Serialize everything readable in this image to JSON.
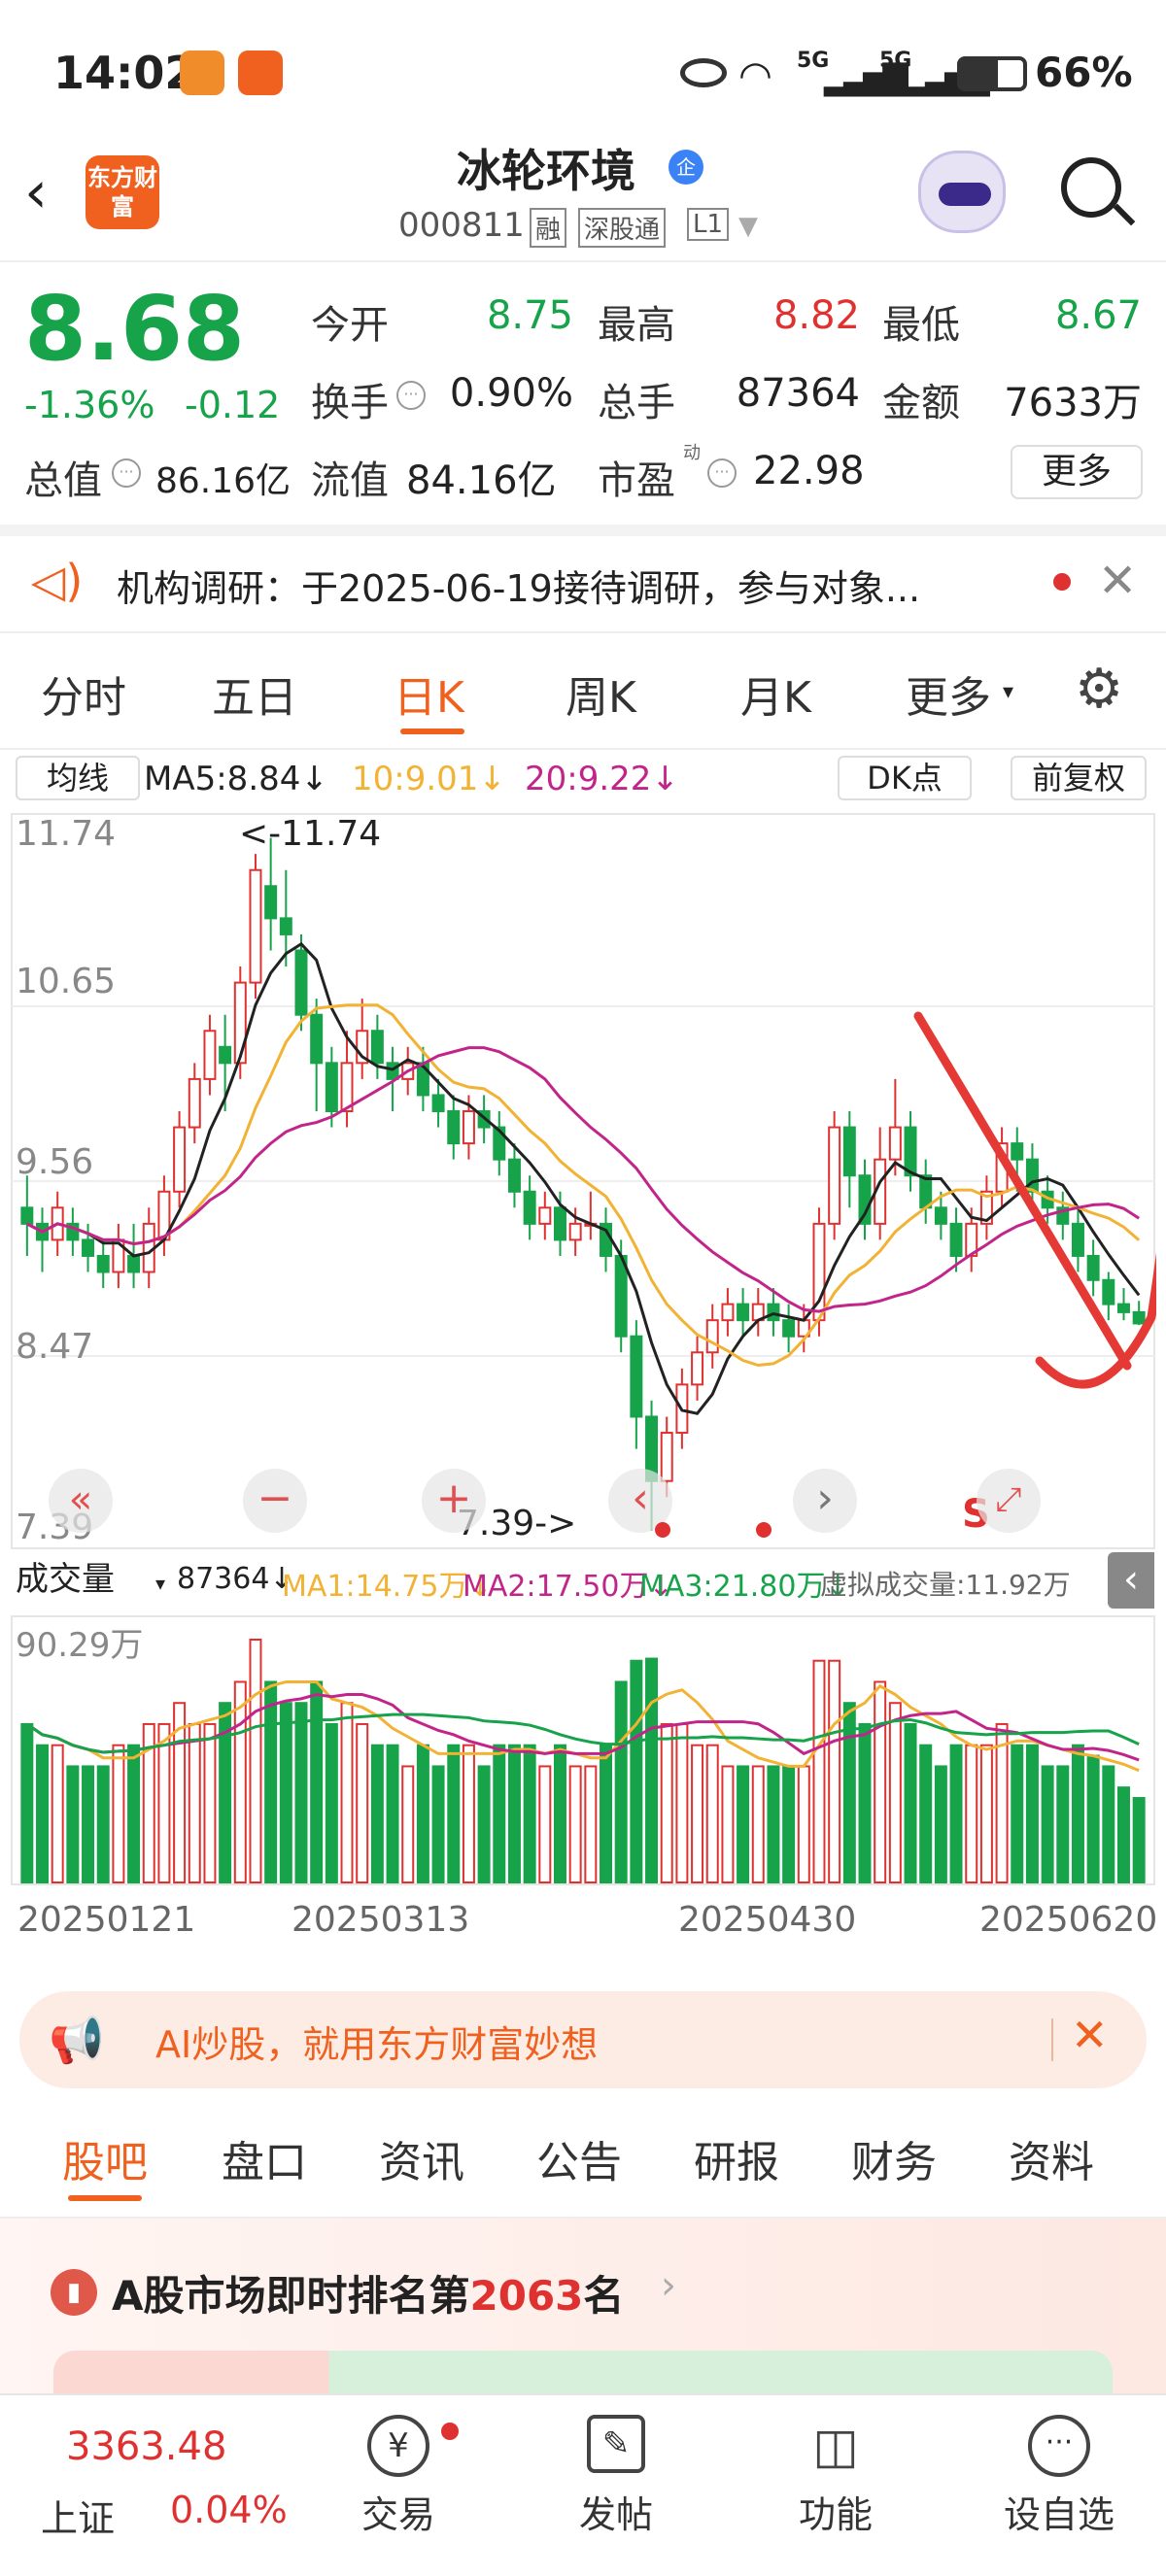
{
  "status": {
    "time": "14:02",
    "battery": "66%",
    "net1": "5G",
    "net2": "5G"
  },
  "header": {
    "logo": "东方财富",
    "name": "冰轮环境",
    "name_badge": "企",
    "code": "000811",
    "tags": [
      "融",
      "深股通",
      "L1"
    ]
  },
  "quote": {
    "price": "8.68",
    "change_pct": "-1.36%",
    "change": "-0.12",
    "open_label": "今开",
    "open": "8.75",
    "high_label": "最高",
    "high": "8.82",
    "low_label": "最低",
    "low": "8.67",
    "turnover_label": "换手",
    "turnover": "0.90%",
    "vol_label": "总手",
    "vol": "87364",
    "amount_label": "金额",
    "amount": "7633万",
    "mcap_label": "总值",
    "mcap": "86.16亿",
    "float_label": "流值",
    "float": "84.16亿",
    "pe_label": "市盈",
    "pe_sup": "动",
    "pe": "22.98",
    "more": "更多"
  },
  "notice": {
    "text": "机构调研：于2025-06-19接待调研，参与对象..."
  },
  "tabs": [
    "分时",
    "五日",
    "日K",
    "周K",
    "月K",
    "更多"
  ],
  "active_tab": "日K",
  "chart_header": {
    "ma_btn": "均线",
    "ma5": "MA5:8.84↓",
    "ma10": "10:9.01↓",
    "ma20": "20:9.22↓",
    "dk": "DK点",
    "adjust": "前复权"
  },
  "price_axis": [
    "11.74",
    "10.65",
    "9.56",
    "8.47",
    "7.39"
  ],
  "annotations": {
    "high": "<-11.74",
    "low": "7.39->"
  },
  "colors": {
    "up": "#e03131",
    "down": "#16a34a",
    "ma5": "#222222",
    "ma10": "#f2b233",
    "ma20": "#c2258a",
    "accent": "#f0601e"
  },
  "volume_header": {
    "btn": "成交量",
    "vol": "87364↓",
    "ma1": "MA1:14.75万↓",
    "ma2": "MA2:17.50万↓",
    "ma3": "MA3:21.80万↓",
    "virtual": "虚拟成交量:11.92万"
  },
  "volume_axis": "90.29万",
  "date_axis": [
    "20250121",
    "20250313",
    "20250430",
    "20250620"
  ],
  "chart_controls": {
    "s_label": "S"
  },
  "ad": {
    "text": "AI炒股，就用东方财富妙想"
  },
  "subtabs": [
    "股吧",
    "盘口",
    "资讯",
    "公告",
    "研报",
    "财务",
    "资料"
  ],
  "active_subtab": "股吧",
  "rank": {
    "prefix": "A股市场即时排名第",
    "num": "2063",
    "suffix": "名"
  },
  "bottom": {
    "index_val": "3363.48",
    "index_name": "上证",
    "index_pct": "0.04%",
    "trade": "交易",
    "post": "发帖",
    "func": "功能",
    "watch": "设自选"
  },
  "chart_data": {
    "type": "candlestick",
    "ylim": [
      7.39,
      11.74
    ],
    "candles": [
      [
        9.4,
        9.3,
        9.6,
        9.1
      ],
      [
        9.3,
        9.2,
        9.4,
        9.0
      ],
      [
        9.2,
        9.4,
        9.5,
        9.1
      ],
      [
        9.3,
        9.2,
        9.4,
        9.1
      ],
      [
        9.2,
        9.1,
        9.3,
        9.0
      ],
      [
        9.1,
        9.0,
        9.2,
        8.9
      ],
      [
        9.0,
        9.2,
        9.3,
        8.9
      ],
      [
        9.1,
        9.0,
        9.3,
        8.9
      ],
      [
        9.0,
        9.3,
        9.4,
        8.9
      ],
      [
        9.2,
        9.5,
        9.6,
        9.1
      ],
      [
        9.5,
        9.9,
        10.0,
        9.4
      ],
      [
        9.9,
        10.2,
        10.3,
        9.8
      ],
      [
        10.2,
        10.5,
        10.6,
        10.1
      ],
      [
        10.4,
        10.3,
        10.6,
        10.0
      ],
      [
        10.3,
        10.8,
        10.9,
        10.2
      ],
      [
        10.8,
        11.5,
        11.6,
        10.7
      ],
      [
        11.4,
        11.2,
        11.7,
        11.0
      ],
      [
        11.2,
        11.1,
        11.5,
        10.9
      ],
      [
        11.0,
        10.6,
        11.1,
        10.5
      ],
      [
        10.6,
        10.3,
        10.7,
        10.0
      ],
      [
        10.3,
        10.0,
        10.4,
        9.9
      ],
      [
        10.0,
        10.3,
        10.5,
        9.9
      ],
      [
        10.3,
        10.5,
        10.7,
        10.2
      ],
      [
        10.5,
        10.3,
        10.6,
        10.2
      ],
      [
        10.3,
        10.2,
        10.4,
        10.0
      ],
      [
        10.2,
        10.3,
        10.4,
        10.1
      ],
      [
        10.3,
        10.1,
        10.4,
        10.0
      ],
      [
        10.1,
        10.0,
        10.2,
        9.9
      ],
      [
        10.0,
        9.8,
        10.1,
        9.7
      ],
      [
        9.8,
        10.0,
        10.1,
        9.7
      ],
      [
        10.0,
        9.9,
        10.1,
        9.8
      ],
      [
        9.9,
        9.7,
        10.0,
        9.6
      ],
      [
        9.7,
        9.5,
        9.8,
        9.4
      ],
      [
        9.5,
        9.3,
        9.6,
        9.2
      ],
      [
        9.3,
        9.4,
        9.5,
        9.2
      ],
      [
        9.4,
        9.2,
        9.5,
        9.1
      ],
      [
        9.2,
        9.3,
        9.4,
        9.1
      ],
      [
        9.3,
        9.3,
        9.5,
        9.2
      ],
      [
        9.3,
        9.1,
        9.4,
        9.0
      ],
      [
        9.1,
        8.6,
        9.2,
        8.5
      ],
      [
        8.6,
        8.1,
        8.7,
        7.9
      ],
      [
        8.1,
        7.7,
        8.2,
        7.39
      ],
      [
        7.7,
        8.0,
        8.1,
        7.6
      ],
      [
        8.0,
        8.3,
        8.4,
        7.9
      ],
      [
        8.3,
        8.5,
        8.6,
        8.2
      ],
      [
        8.5,
        8.7,
        8.8,
        8.4
      ],
      [
        8.7,
        8.8,
        8.9,
        8.6
      ],
      [
        8.8,
        8.7,
        8.9,
        8.6
      ],
      [
        8.7,
        8.8,
        8.9,
        8.6
      ],
      [
        8.8,
        8.7,
        8.9,
        8.6
      ],
      [
        8.7,
        8.6,
        8.8,
        8.5
      ],
      [
        8.6,
        8.7,
        8.8,
        8.5
      ],
      [
        8.7,
        9.3,
        9.4,
        8.6
      ],
      [
        9.3,
        9.9,
        10.0,
        9.2
      ],
      [
        9.9,
        9.6,
        10.0,
        9.4
      ],
      [
        9.6,
        9.3,
        9.7,
        9.2
      ],
      [
        9.3,
        9.7,
        9.9,
        9.2
      ],
      [
        9.7,
        9.9,
        10.2,
        9.6
      ],
      [
        9.9,
        9.6,
        10.0,
        9.5
      ],
      [
        9.6,
        9.4,
        9.7,
        9.3
      ],
      [
        9.4,
        9.3,
        9.5,
        9.2
      ],
      [
        9.3,
        9.1,
        9.4,
        9.0
      ],
      [
        9.1,
        9.3,
        9.4,
        9.0
      ],
      [
        9.3,
        9.5,
        9.6,
        9.2
      ],
      [
        9.5,
        9.8,
        9.9,
        9.4
      ],
      [
        9.8,
        9.7,
        9.9,
        9.5
      ],
      [
        9.7,
        9.5,
        9.8,
        9.4
      ],
      [
        9.5,
        9.4,
        9.6,
        9.3
      ],
      [
        9.4,
        9.3,
        9.5,
        9.2
      ],
      [
        9.3,
        9.1,
        9.4,
        9.0
      ],
      [
        9.1,
        8.95,
        9.2,
        8.85
      ],
      [
        8.95,
        8.8,
        9.0,
        8.7
      ],
      [
        8.8,
        8.75,
        8.9,
        8.7
      ],
      [
        8.75,
        8.68,
        8.82,
        8.67
      ]
    ]
  }
}
